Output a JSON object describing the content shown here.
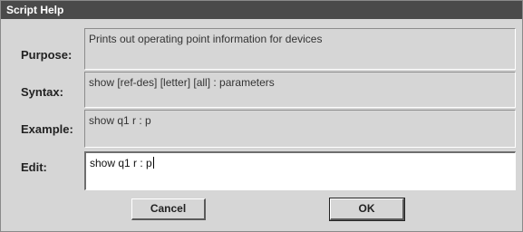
{
  "window": {
    "title": "Script Help"
  },
  "rows": {
    "purpose": {
      "label": "Purpose:",
      "value": "Prints out operating point information for devices"
    },
    "syntax": {
      "label": "Syntax:",
      "value": "show [ref-des] [letter] [all] : parameters"
    },
    "example": {
      "label": "Example:",
      "value": "show q1 r : p"
    },
    "edit": {
      "label": "Edit:",
      "value": "show q1 r : p"
    }
  },
  "buttons": {
    "cancel": "Cancel",
    "ok": "OK"
  }
}
